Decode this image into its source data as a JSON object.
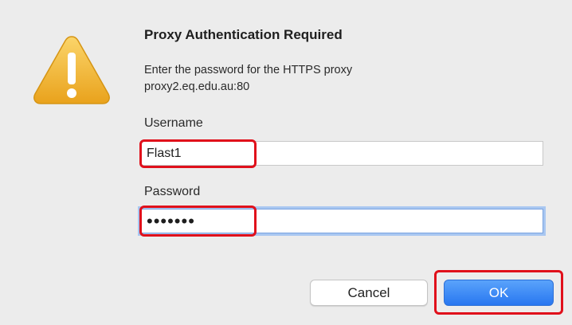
{
  "dialog": {
    "title": "Proxy Authentication Required",
    "message_line1": "Enter the password for the HTTPS proxy",
    "message_line2": "proxy2.eq.edu.au:80",
    "icon": "warning-icon",
    "username_label": "Username",
    "username_value": "Flast1",
    "password_label": "Password",
    "password_value": "•••••••",
    "cancel_label": "Cancel",
    "ok_label": "OK"
  },
  "colors": {
    "highlight": "#e0101b",
    "ok_button": "#2877f0",
    "warning_icon": "#f0b429"
  }
}
